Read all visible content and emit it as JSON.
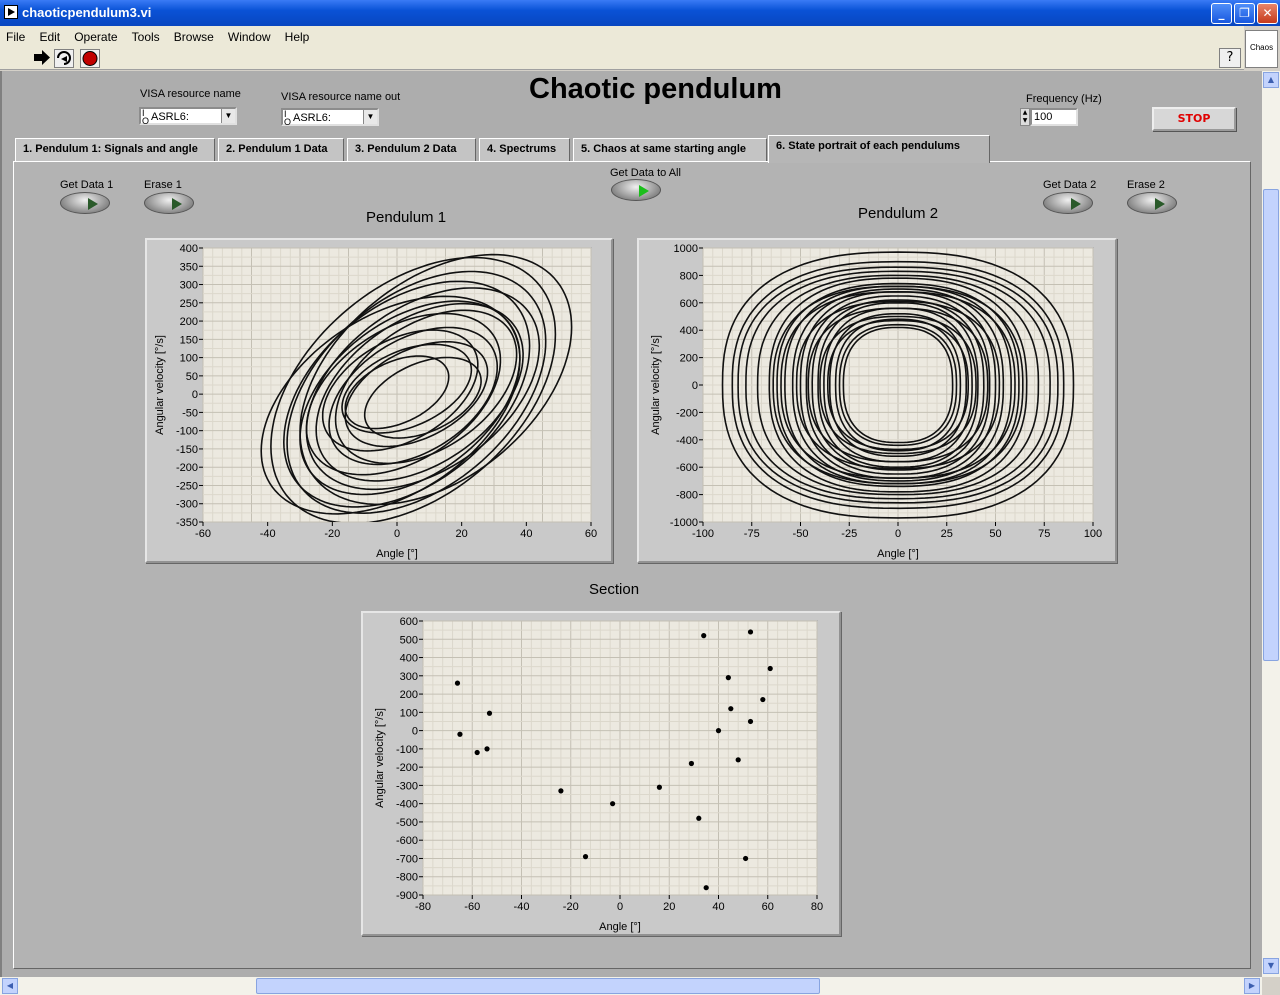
{
  "window": {
    "title": "chaoticpendulum3.vi",
    "minimize": "_",
    "restore": "❐",
    "close": "✕"
  },
  "menu": [
    "File",
    "Edit",
    "Operate",
    "Tools",
    "Browse",
    "Window",
    "Help"
  ],
  "toolbar": {
    "run_icon": "run-arrow-icon",
    "run_continuous_icon": "run-continuous-icon",
    "abort_icon": "abort-icon",
    "help": "?",
    "vi_icon_label": "Chaos"
  },
  "controls": {
    "visa_in_label": "VISA resource name",
    "visa_in_value": "ASRL6:",
    "visa_out_label": "VISA resource name out",
    "visa_out_value": "ASRL6:",
    "frequency_label": "Frequency (Hz)",
    "frequency_value": "100",
    "stop_label": "STOP"
  },
  "page_title": "Chaotic pendulum",
  "tabs": [
    {
      "label": "1. Pendulum 1: Signals and angle",
      "active": false
    },
    {
      "label": "2. Pendulum 1 Data",
      "active": false
    },
    {
      "label": "3. Pendulum 2 Data",
      "active": false
    },
    {
      "label": "4. Spectrums",
      "active": false
    },
    {
      "label": "5. Chaos at same starting angle",
      "active": false
    },
    {
      "label": "6. State portrait of each pendulums",
      "active": true
    }
  ],
  "buttons": {
    "get_data_1": "Get Data 1",
    "erase_1": "Erase 1",
    "get_data_all": "Get Data to All",
    "get_data_2": "Get Data 2",
    "erase_2": "Erase 2"
  },
  "chart_data": [
    {
      "type": "line",
      "title": "Pendulum 1",
      "xlabel": "Angle [°]",
      "ylabel": "Angular velocity [°/s]",
      "xlim": [
        -60,
        60
      ],
      "ylim": [
        -350,
        400
      ],
      "xticks": [
        -60,
        -40,
        -20,
        0,
        20,
        40,
        60
      ],
      "yticks": [
        400,
        350,
        300,
        250,
        200,
        150,
        100,
        50,
        0,
        -50,
        -100,
        -150,
        -200,
        -250,
        -300,
        -350
      ],
      "grid": true,
      "description_of_series": "phase portrait trajectory (tilted loops, center approx. angle 5, velocity 0, angle amplitude 15-45, velocity amplitude 100-350)",
      "series": [
        {
          "loops": [
            {
              "cx": 5,
              "cy": 10,
              "ax": 44,
              "ay": 330
            },
            {
              "cx": 6,
              "cy": 5,
              "ax": 40,
              "ay": 300
            },
            {
              "cx": 3,
              "cy": 0,
              "ax": 38,
              "ay": 280
            },
            {
              "cx": 8,
              "cy": 15,
              "ax": 36,
              "ay": 250
            },
            {
              "cx": 4,
              "cy": -10,
              "ax": 34,
              "ay": 240
            },
            {
              "cx": 7,
              "cy": 5,
              "ax": 32,
              "ay": 220
            },
            {
              "cx": 2,
              "cy": 0,
              "ax": 30,
              "ay": 200
            },
            {
              "cx": 9,
              "cy": 20,
              "ax": 28,
              "ay": 190
            },
            {
              "cx": 5,
              "cy": -5,
              "ax": 26,
              "ay": 170
            },
            {
              "cx": 1,
              "cy": 10,
              "ax": 24,
              "ay": 150
            },
            {
              "cx": 6,
              "cy": 0,
              "ax": 22,
              "ay": 130
            },
            {
              "cx": 3,
              "cy": 15,
              "ax": 20,
              "ay": 110
            },
            {
              "cx": 8,
              "cy": -10,
              "ax": 18,
              "ay": 100
            },
            {
              "cx": 0,
              "cy": 5,
              "ax": 16,
              "ay": 90
            },
            {
              "cx": 12,
              "cy": 40,
              "ax": 42,
              "ay": 310
            },
            {
              "cx": -2,
              "cy": -30,
              "ax": 40,
              "ay": 270
            }
          ]
        }
      ]
    },
    {
      "type": "line",
      "title": "Pendulum 2",
      "xlabel": "Angle [°]",
      "ylabel": "Angular velocity [°/s]",
      "xlim": [
        -100,
        100
      ],
      "ylim": [
        -1000,
        1000
      ],
      "xticks": [
        -100,
        -75,
        -50,
        -25,
        0,
        25,
        50,
        75,
        100
      ],
      "yticks": [
        1000,
        800,
        600,
        400,
        200,
        0,
        -200,
        -400,
        -600,
        -800,
        -1000
      ],
      "grid": true,
      "description_of_series": "phase portrait: nested near-elliptical loops centered at origin, angle amplitude 30-90, velocity amplitude 420-980",
      "series": [
        {
          "loops": [
            {
              "ax": 90,
              "ay": 970
            },
            {
              "ax": 85,
              "ay": 900
            },
            {
              "ax": 82,
              "ay": 860
            },
            {
              "ax": 78,
              "ay": 830
            },
            {
              "ax": 72,
              "ay": 800
            },
            {
              "ax": 66,
              "ay": 780
            },
            {
              "ax": 62,
              "ay": 740
            },
            {
              "ax": 58,
              "ay": 720
            },
            {
              "ax": 54,
              "ay": 700
            },
            {
              "ax": 50,
              "ay": 680
            },
            {
              "ax": 47,
              "ay": 650
            },
            {
              "ax": 44,
              "ay": 620
            },
            {
              "ax": 41,
              "ay": 600
            },
            {
              "ax": 38,
              "ay": 560
            },
            {
              "ax": 35,
              "ay": 520
            },
            {
              "ax": 32,
              "ay": 480
            },
            {
              "ax": 30,
              "ay": 440
            },
            {
              "ax": 28,
              "ay": 420
            },
            {
              "ax": 60,
              "ay": 680
            },
            {
              "ax": 52,
              "ay": 610
            },
            {
              "ax": 46,
              "ay": 560
            },
            {
              "ax": 40,
              "ay": 500
            },
            {
              "ax": 36,
              "ay": 470
            },
            {
              "ax": 64,
              "ay": 720
            }
          ]
        }
      ]
    },
    {
      "type": "scatter",
      "title": "Section",
      "xlabel": "Angle [°]",
      "ylabel": "Angular velocity [°/s]",
      "xlim": [
        -80,
        80
      ],
      "ylim": [
        -900,
        600
      ],
      "xticks": [
        -80,
        -60,
        -40,
        -20,
        0,
        20,
        40,
        60,
        80
      ],
      "yticks": [
        600,
        500,
        400,
        300,
        200,
        100,
        0,
        -100,
        -200,
        -300,
        -400,
        -500,
        -600,
        -700,
        -800,
        -900
      ],
      "grid": true,
      "points": [
        [
          -66,
          260
        ],
        [
          -65,
          -20
        ],
        [
          -53,
          95
        ],
        [
          -58,
          -120
        ],
        [
          -54,
          -100
        ],
        [
          -24,
          -330
        ],
        [
          -14,
          -690
        ],
        [
          -3,
          -400
        ],
        [
          16,
          -310
        ],
        [
          29,
          -180
        ],
        [
          32,
          -480
        ],
        [
          34,
          520
        ],
        [
          35,
          -860
        ],
        [
          40,
          0
        ],
        [
          44,
          290
        ],
        [
          45,
          120
        ],
        [
          48,
          -160
        ],
        [
          51,
          -700
        ],
        [
          53,
          540
        ],
        [
          53,
          50
        ],
        [
          58,
          170
        ],
        [
          61,
          340
        ]
      ]
    }
  ]
}
